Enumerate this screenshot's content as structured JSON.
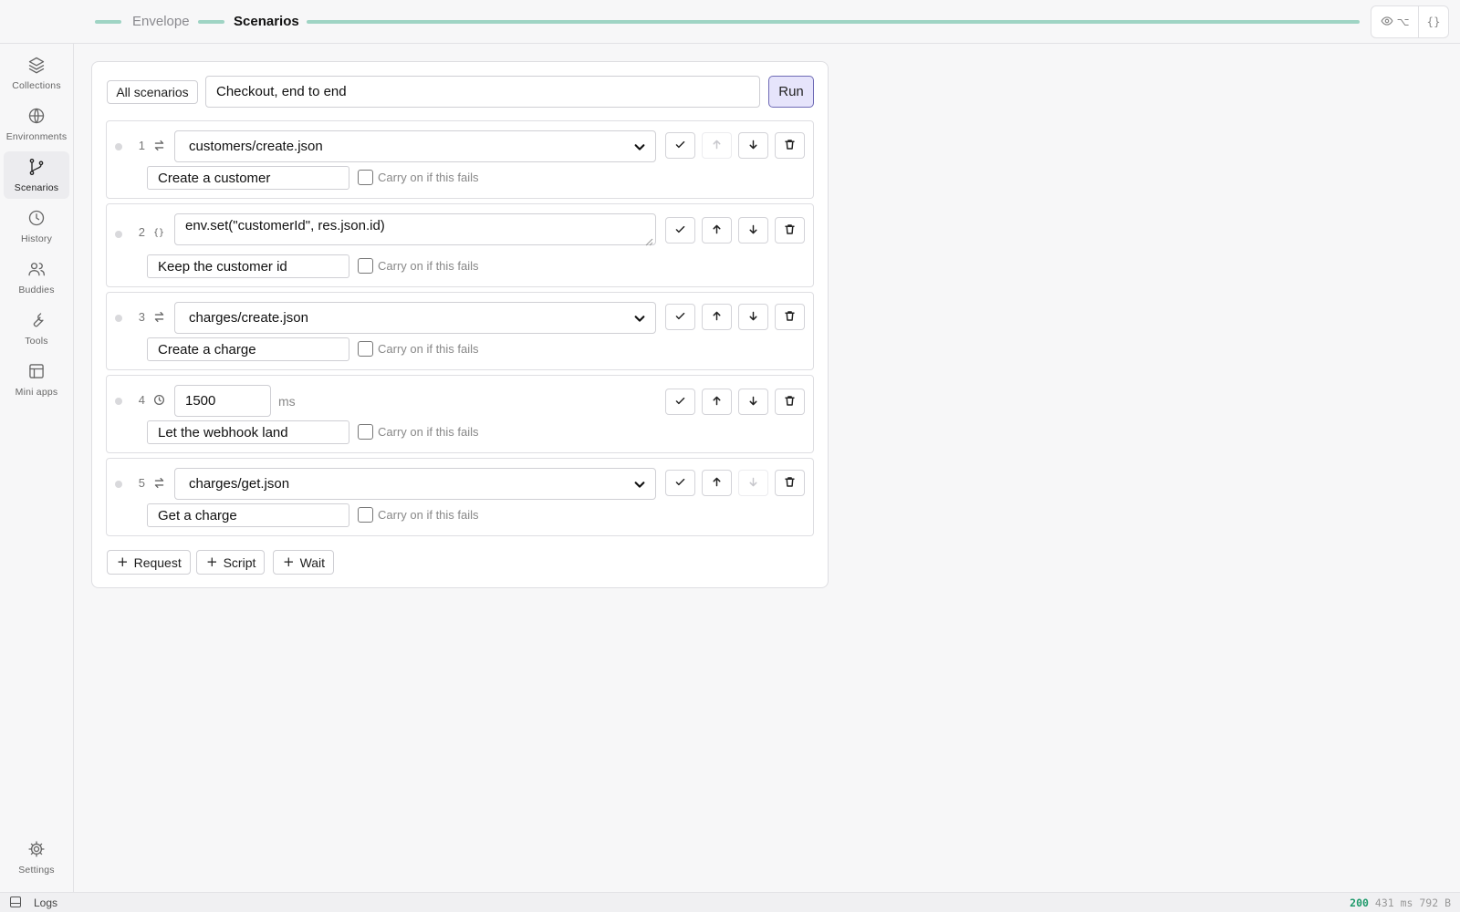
{
  "header": {
    "breadcrumbs": [
      "Envelope",
      "Scenarios"
    ],
    "view_toggle_glyph": "⌥",
    "code_toggle_glyph": "{}"
  },
  "sidebar": {
    "items": [
      {
        "label": "Collections",
        "icon": "layers-icon"
      },
      {
        "label": "Environments",
        "icon": "globe-icon"
      },
      {
        "label": "Scenarios",
        "icon": "git-branch-icon",
        "active": true
      },
      {
        "label": "History",
        "icon": "clock-icon"
      },
      {
        "label": "Buddies",
        "icon": "users-icon"
      },
      {
        "label": "Tools",
        "icon": "wrench-icon"
      },
      {
        "label": "Mini apps",
        "icon": "layout-icon"
      }
    ],
    "settings_label": "Settings"
  },
  "toolbar": {
    "all_scenarios_label": "All scenarios",
    "scenario_name": "Checkout, end to end",
    "run_label": "Run"
  },
  "steps": [
    {
      "number": "1",
      "kind": "request",
      "target": "customers/create.json",
      "name": "Create a customer",
      "carry_on_label": "Carry on if this fails",
      "carry_on": false
    },
    {
      "number": "2",
      "kind": "script",
      "type_glyph": "{}",
      "code": "env.set(\"customerId\", res.json.id)",
      "name": "Keep the customer id",
      "carry_on_label": "Carry on if this fails",
      "carry_on": false
    },
    {
      "number": "3",
      "kind": "request",
      "target": "charges/create.json",
      "name": "Create a charge",
      "carry_on_label": "Carry on if this fails",
      "carry_on": false
    },
    {
      "number": "4",
      "kind": "wait",
      "duration": "1500",
      "unit": "ms",
      "name": "Let the webhook land",
      "carry_on_label": "Carry on if this fails",
      "carry_on": false
    },
    {
      "number": "5",
      "kind": "request",
      "target": "charges/get.json",
      "name": "Get a charge",
      "carry_on_label": "Carry on if this fails",
      "carry_on": false
    }
  ],
  "add_buttons": {
    "request": "Request",
    "script": "Script",
    "wait": "Wait"
  },
  "statusbar": {
    "logs_label": "Logs",
    "status_code": "200",
    "timing": "431 ms",
    "size": "792 B"
  },
  "colors": {
    "accent": "#6e6ab5",
    "accent_bg": "#e6e4fb",
    "progress": "#9fd4c4",
    "status_ok": "#1e9a6b"
  }
}
